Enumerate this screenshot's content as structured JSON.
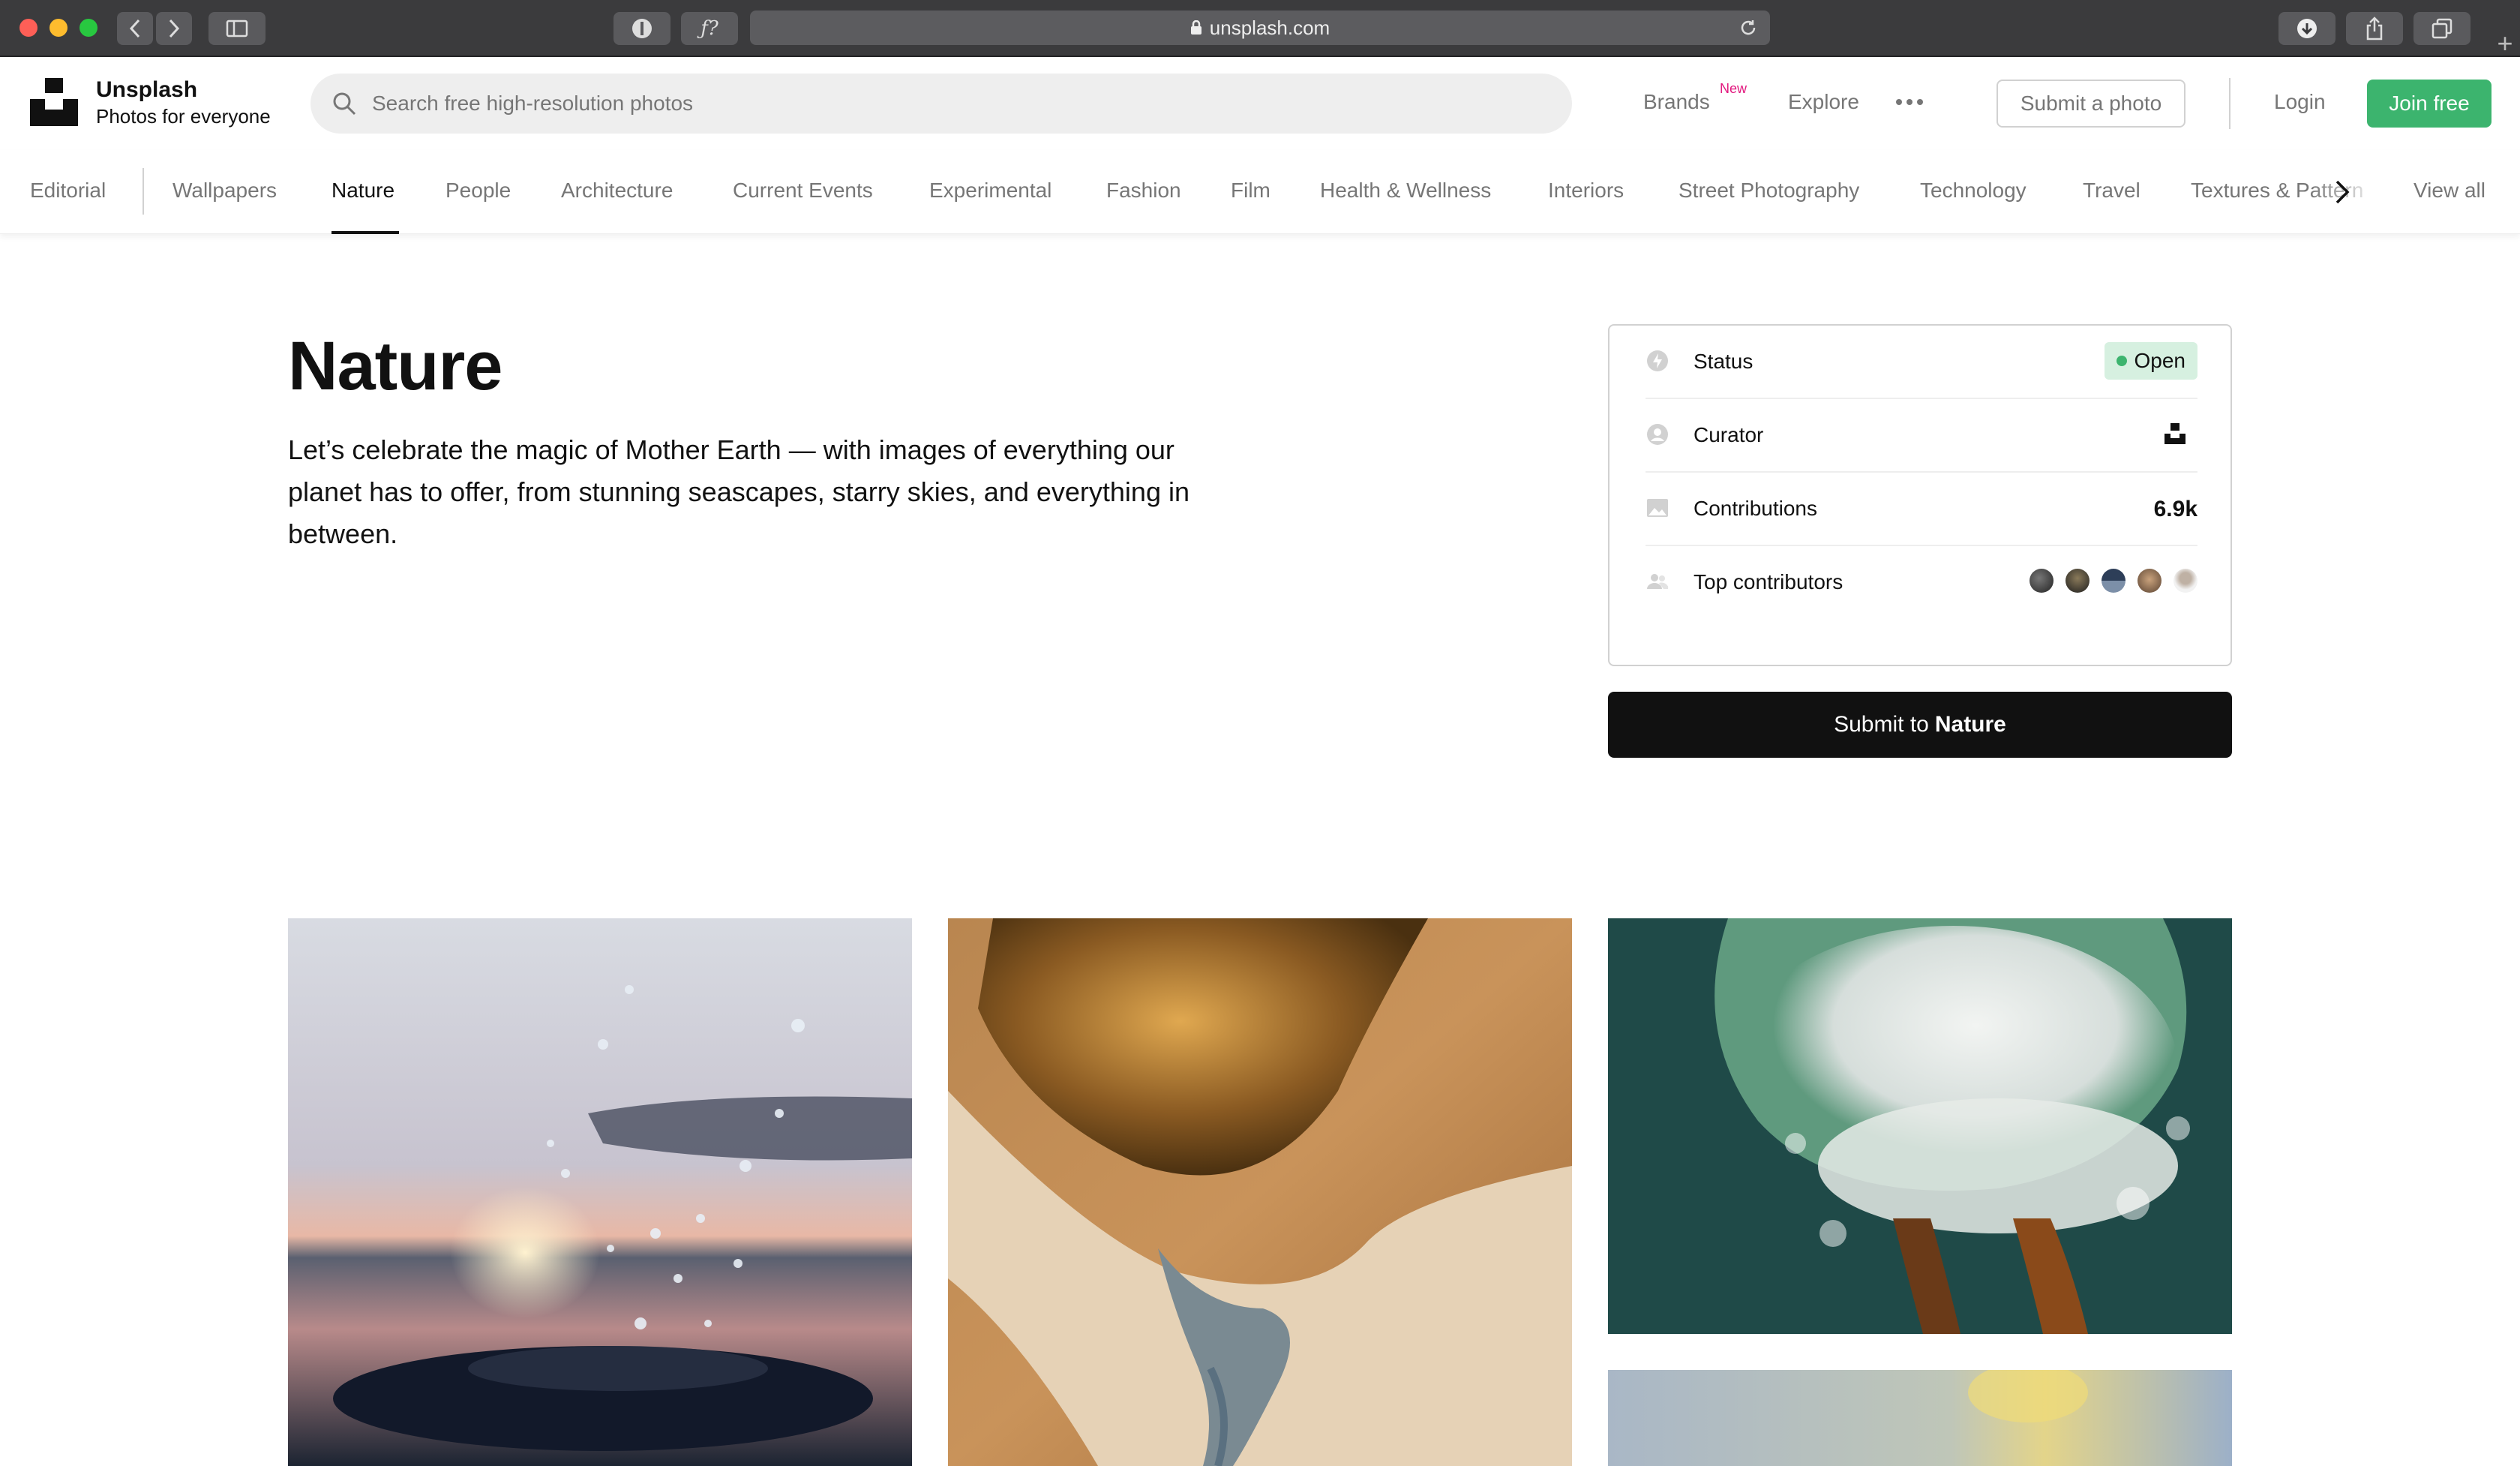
{
  "browser": {
    "url": "unsplash.com",
    "traffic_lights": [
      "#fe5f57",
      "#febc2e",
      "#28c840"
    ]
  },
  "header": {
    "brand_name": "Unsplash",
    "brand_tagline": "Photos for everyone",
    "search_placeholder": "Search free high-resolution photos",
    "nav": {
      "brands": "Brands",
      "brands_badge": "New",
      "explore": "Explore",
      "submit_photo": "Submit a photo",
      "login": "Login",
      "join": "Join free"
    },
    "colors": {
      "join_bg": "#3cb46e",
      "badge": "#e2187e"
    }
  },
  "topics": {
    "items": [
      "Editorial",
      "Wallpapers",
      "Nature",
      "People",
      "Architecture",
      "Current Events",
      "Experimental",
      "Fashion",
      "Film",
      "Health & Wellness",
      "Interiors",
      "Street Photography",
      "Technology",
      "Travel",
      "Textures & Pattern"
    ],
    "active": "Nature",
    "view_all": "View all"
  },
  "main": {
    "title": "Nature",
    "description": "Let’s celebrate the magic of Mother Earth — with images of everything our planet has to offer, from stunning seascapes, starry skies, and everything in between."
  },
  "info_card": {
    "status_label": "Status",
    "status_value": "Open",
    "curator_label": "Curator",
    "contributions_label": "Contributions",
    "contributions_value": "6.9k",
    "top_contributors_label": "Top contributors",
    "avatar_colors": [
      "#3a3a3a",
      "#2b2b2b",
      "#4f6a8a",
      "#6b5a4a",
      "#cfcfcf"
    ]
  },
  "submit_button": {
    "prefix": "Submit to",
    "topic": "Nature"
  },
  "photos": [
    {
      "subject": "water splash at sunset"
    },
    {
      "subject": "aerial sand and vegetation"
    },
    {
      "subject": "aerial waterfall"
    },
    {
      "subject": "blurred landscape"
    }
  ]
}
